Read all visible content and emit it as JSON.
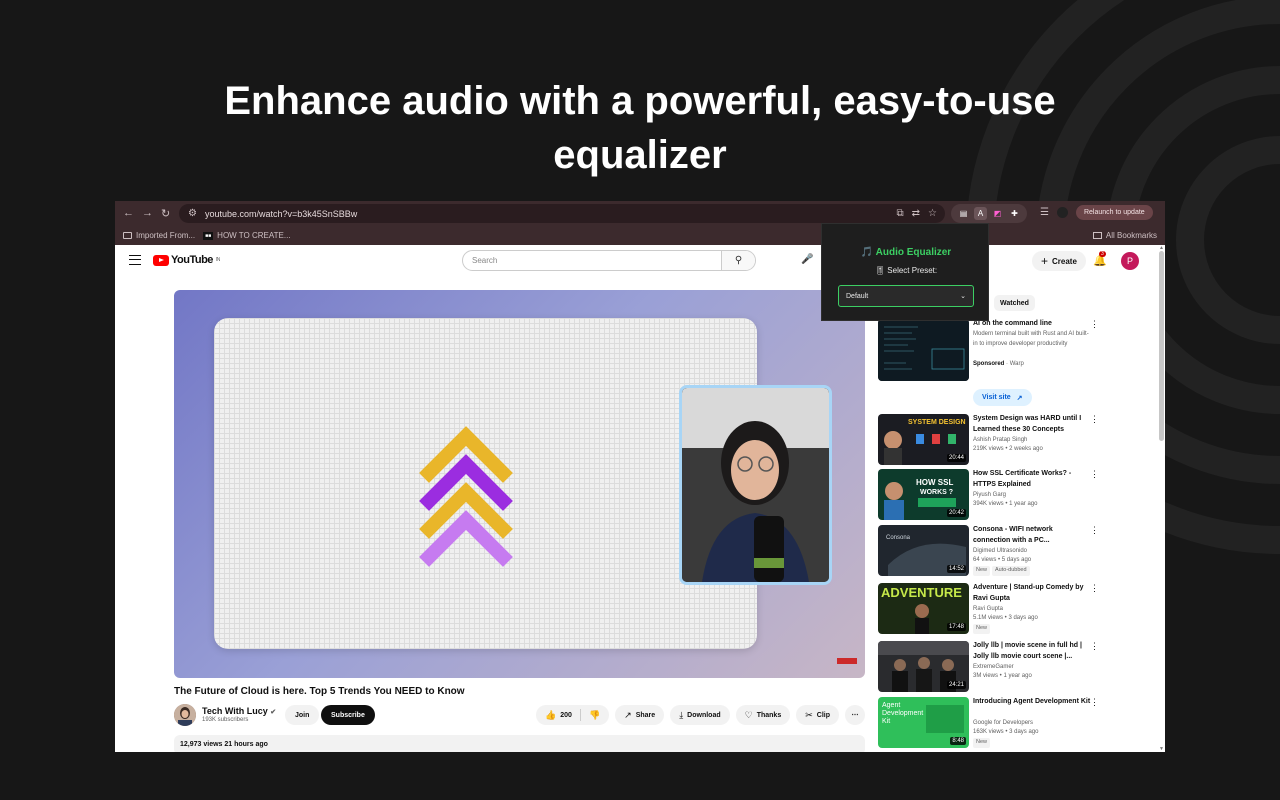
{
  "headline": {
    "line1": "Enhance audio with a powerful, easy-to-use",
    "line2": "equalizer"
  },
  "browser": {
    "url": "youtube.com/watch?v=b3k45SnSBBw",
    "relaunch_label": "Relaunch to update",
    "bookmarks": [
      {
        "label": "Imported From..."
      },
      {
        "label": "HOW TO CREATE..."
      }
    ],
    "all_bookmarks_label": "All Bookmarks"
  },
  "youtube": {
    "logo_text": "YouTube",
    "logo_region": "IN",
    "search_placeholder": "Search",
    "create_label": "Create",
    "notifications_count": "3",
    "avatar_letter": "P",
    "video": {
      "title": "The Future of Cloud is here. Top 5 Trends You NEED to Know",
      "channel": "Tech With Lucy",
      "subscribers": "193K subscribers",
      "join_label": "Join",
      "subscribe_label": "Subscribe",
      "likes": "200",
      "share_label": "Share",
      "download_label": "Download",
      "thanks_label": "Thanks",
      "clip_label": "Clip",
      "views_time": "12,973 views  21 hours ago"
    },
    "watched_chip": "Watched",
    "recommendations": [
      {
        "title": "AI on the command line",
        "meta1": "Modern terminal built with Rust and AI built-in to improve developer productivity",
        "sponsored": "Sponsored",
        "advertiser": "Warp",
        "visit_label": "Visit site"
      },
      {
        "title": "System Design was HARD until I Learned these 30 Concepts",
        "channel": "Ashish Pratap Singh",
        "stats": "219K views • 2 weeks ago",
        "duration": "20:44",
        "thumb_text": "SYSTEM DESIGN"
      },
      {
        "title": "How SSL Certificate Works? - HTTPS Explained",
        "channel": "Piyush Garg",
        "stats": "394K views • 1 year ago",
        "duration": "20:42",
        "thumb_text": "HOW SSL WORKS ?"
      },
      {
        "title": "Consona - WIFI network connection with a PC...",
        "channel": "Digimed Ultrasonido",
        "stats": "64 views • 5 days ago",
        "tag1": "New",
        "tag2": "Auto-dubbed",
        "duration": "14:52",
        "thumb_text": "Consona"
      },
      {
        "title": "Adventure | Stand-up Comedy by Ravi Gupta",
        "channel": "Ravi Gupta",
        "stats": "5.1M views • 3 days ago",
        "tag1": "New",
        "duration": "17:48",
        "thumb_text": "ADVENTURE"
      },
      {
        "title": "Jolly llb | movie scene in full hd | Jolly llb movie court scene |...",
        "channel": "ExtremeGamer",
        "stats": "3M views • 1 year ago",
        "duration": "24:21"
      },
      {
        "title": "Introducing Agent Development Kit",
        "channel": "Google for Developers",
        "stats": "163K views • 3 days ago",
        "tag1": "New",
        "duration": "8:48",
        "thumb_text": "Agent Development Kit"
      }
    ]
  },
  "equalizer": {
    "title": "🎵 Audio Equalizer",
    "select_label": "🎚 Select Preset:",
    "selected_preset": "Default"
  }
}
